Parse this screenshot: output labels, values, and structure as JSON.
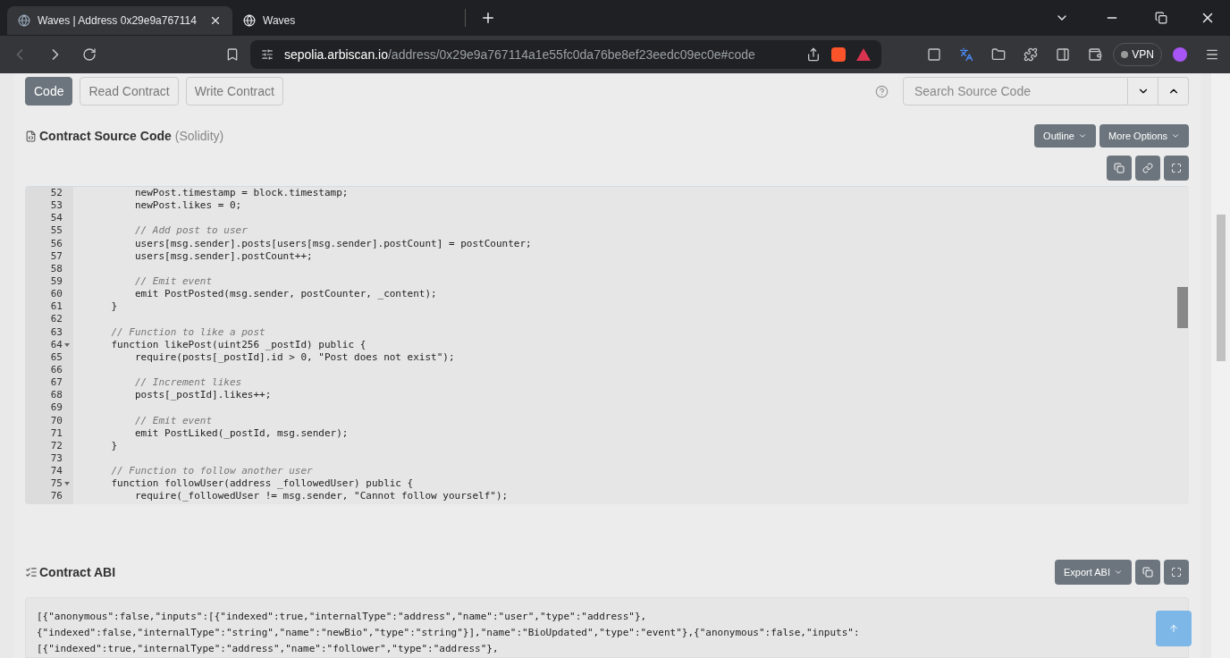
{
  "tabs": [
    {
      "title": "Waves | Address 0x29e9a767114",
      "selected": true
    },
    {
      "title": "Waves",
      "selected": false
    }
  ],
  "address_bar": {
    "host": "sepolia.arbiscan.io",
    "path": "/address/0x29e9a767114a1e55fc0da76be8ef23eedc09ec0e#code"
  },
  "vpn": "VPN",
  "contract_tabs": [
    {
      "label": "Code",
      "selected": true
    },
    {
      "label": "Read Contract",
      "selected": false
    },
    {
      "label": "Write Contract",
      "selected": false
    }
  ],
  "search": {
    "placeholder": "Search Source Code"
  },
  "source": {
    "title": "Contract Source Code",
    "language": "(Solidity)",
    "buttons": [
      "Outline",
      "More Options"
    ],
    "lines": [
      {
        "number": "52",
        "text": "        newPost.timestamp = block.timestamp;",
        "kind": "code",
        "fold": false
      },
      {
        "number": "53",
        "text": "        newPost.likes = 0;",
        "kind": "code",
        "fold": false
      },
      {
        "number": "54",
        "kind": "blank",
        "fold": false
      },
      {
        "number": "55",
        "text": "        // Add post to user",
        "kind": "comment",
        "fold": false
      },
      {
        "number": "56",
        "text": "        users[msg.sender].posts[users[msg.sender].postCount] = postCounter;",
        "kind": "code",
        "fold": false
      },
      {
        "number": "57",
        "text": "        users[msg.sender].postCount++;",
        "kind": "code",
        "fold": false
      },
      {
        "number": "58",
        "kind": "blank",
        "fold": false
      },
      {
        "number": "59",
        "text": "        // Emit event",
        "kind": "comment",
        "fold": false
      },
      {
        "number": "60",
        "text": "        emit PostPosted(msg.sender, postCounter, _content);",
        "kind": "code",
        "fold": false
      },
      {
        "number": "61",
        "text": "    }",
        "kind": "code",
        "fold": false
      },
      {
        "number": "62",
        "kind": "blank",
        "fold": false
      },
      {
        "number": "63",
        "text": "    // Function to like a post",
        "kind": "comment",
        "fold": false
      },
      {
        "number": "64",
        "text": "    function likePost(uint256 _postId) public {",
        "kind": "code",
        "fold": true
      },
      {
        "number": "65",
        "text": "        require(posts[_postId].id > 0, \"Post does not exist\");",
        "kind": "code",
        "fold": false
      },
      {
        "number": "66",
        "kind": "blank",
        "fold": false
      },
      {
        "number": "67",
        "text": "        // Increment likes",
        "kind": "comment",
        "fold": false
      },
      {
        "number": "68",
        "text": "        posts[_postId].likes++;",
        "kind": "code",
        "fold": false
      },
      {
        "number": "69",
        "kind": "blank",
        "fold": false
      },
      {
        "number": "70",
        "text": "        // Emit event",
        "kind": "comment",
        "fold": false
      },
      {
        "number": "71",
        "text": "        emit PostLiked(_postId, msg.sender);",
        "kind": "code",
        "fold": false
      },
      {
        "number": "72",
        "text": "    }",
        "kind": "code",
        "fold": false
      },
      {
        "number": "73",
        "kind": "blank",
        "fold": false
      },
      {
        "number": "74",
        "text": "    // Function to follow another user",
        "kind": "comment",
        "fold": false
      },
      {
        "number": "75",
        "text": "    function followUser(address _followedUser) public {",
        "kind": "code",
        "fold": true
      },
      {
        "number": "76",
        "text": "        require(_followedUser != msg.sender, \"Cannot follow yourself\");",
        "kind": "code",
        "fold": false
      }
    ]
  },
  "abi": {
    "title": "Contract ABI",
    "export_button": "Export ABI",
    "lines": [
      "[{\"anonymous\":false,\"inputs\":[{\"indexed\":true,\"internalType\":\"address\",\"name\":\"user\",\"type\":\"address\"},",
      "{\"indexed\":false,\"internalType\":\"string\",\"name\":\"newBio\",\"type\":\"string\"}],\"name\":\"BioUpdated\",\"type\":\"event\"},{\"anonymous\":false,\"inputs\":",
      "[{\"indexed\":true,\"internalType\":\"address\",\"name\":\"follower\",\"type\":\"address\"},"
    ]
  }
}
